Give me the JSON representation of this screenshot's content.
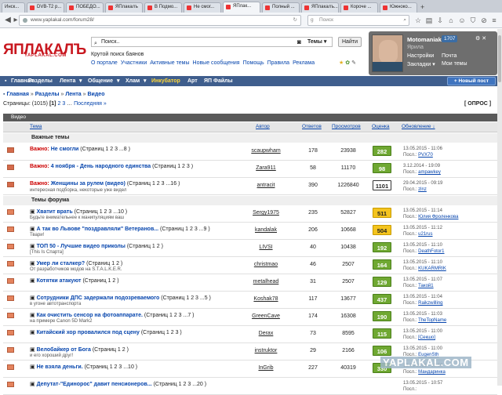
{
  "browser": {
    "tabs": [
      "Инск...",
      "DVB-T2 р...",
      "ПОБЕДО...",
      "ЯПлакалъ",
      "В Подмо...",
      "Не смог...",
      "ЯПлак...",
      "Полный ...",
      "ЯПлакалъ...",
      "Короче ...",
      "Южноко..."
    ],
    "active_tab": 6,
    "url": "www.yaplakal.com/forum28/",
    "search_placeholder": "Поиск"
  },
  "site": {
    "logo": "ЯПЛАКАЛЪ",
    "logo_sub": "YAPLAKAL.COM",
    "search_value": "Поиск..",
    "search_scope": "Темы",
    "find_button": "Найти",
    "tagline": "Крутой поиск баянов",
    "links": [
      "О портале",
      "Участники",
      "Активные темы",
      "Новые сообщения",
      "Помощь",
      "Правила",
      "Реклама"
    ]
  },
  "user": {
    "name": "Motomaniak",
    "count": "1707",
    "status": "Ярила",
    "settings": "Настройки",
    "mail": "Почта",
    "bookmarks": "Закладки",
    "my_topics": "Мои темы"
  },
  "menu": {
    "items": [
      "Главная",
      "Разделы",
      "Лента",
      "Общение",
      "Хлам",
      "Инкубатор",
      "Арт",
      "ЯП Файлы"
    ],
    "new_post": "Новый пост"
  },
  "breadcrumb": [
    "Главная",
    "Разделы",
    "Лента",
    "Видео"
  ],
  "pages": {
    "label": "Страницы:",
    "count": "(1015)",
    "current": "[1]",
    "next": [
      "2",
      "3"
    ],
    "last": "Последняя »"
  },
  "opros": "[ ОПРОС ]",
  "section": "Видео",
  "columns": {
    "topic": "Тема",
    "author": "Автор",
    "answers": "Ответов",
    "views": "Просмотров",
    "rating": "Оценка",
    "updated": "Обновление ↓"
  },
  "groups": {
    "important": "Важные темы",
    "forum": "Темы форума"
  },
  "important_rows": [
    {
      "prefix": "Важно:",
      "title": "Не смогли",
      "pages": "(Страниц 1 2 3 ...8 )",
      "desc": "",
      "author": "scaupwham",
      "answers": "178",
      "views": "23938",
      "rating": "282",
      "color": "green",
      "date": "13.05.2015 - 11:06",
      "last": "PVX70"
    },
    {
      "prefix": "Важно:",
      "title": "4 ноября - День народного единства",
      "pages": "(Страниц 1 2 3 )",
      "desc": "",
      "author": "Zara911",
      "answers": "58",
      "views": "11170",
      "rating": "98",
      "color": "green",
      "date": "3.12.2014 - 19:09",
      "last": "ampawkey"
    },
    {
      "prefix": "Важно:",
      "title": "Женщины за рулем (видео)",
      "pages": "(Страниц 1 2 3 ...16 )",
      "desc": "интересная подборка, некоторые уже видел",
      "author": "antracit",
      "answers": "390",
      "views": "1226840",
      "rating": "1101",
      "color": "white",
      "date": "29.04.2015 - 09:19",
      "last": "zlnz"
    }
  ],
  "forum_rows": [
    {
      "title": "Хватит врать",
      "pages": "(Страниц 1 2 3 ...10 )",
      "desc": "Будьте внимательнее к манипуляциям ваш",
      "author": "Sergy1975",
      "answers": "235",
      "views": "52827",
      "rating": "511",
      "color": "yellow",
      "date": "13.05.2015 - 11:14",
      "last": "Юлия Фроленкова"
    },
    {
      "title": "А так во Львове \"поздравляли\" Ветеранов...",
      "pages": "(Страниц 1 2 3 ...9 )",
      "desc": "Твари!",
      "author": "kandalak",
      "answers": "206",
      "views": "10668",
      "rating": "504",
      "color": "yellow",
      "date": "13.05.2015 - 11:12",
      "last": "u21rus"
    },
    {
      "title": "ТОП 50 - Лучшие видео приколы",
      "pages": "(Страниц 1 2 )",
      "desc": "[This Is Спарта]",
      "author": "LIVSI",
      "answers": "40",
      "views": "10438",
      "rating": "192",
      "color": "green",
      "date": "13.05.2015 - 11:10",
      "last": "DeathFotor1"
    },
    {
      "title": "Умер ли сталкер?",
      "pages": "(Страниц 1 2 )",
      "desc": "От разработчиков модов на S.T.A.L.K.E.R.",
      "author": "christmao",
      "answers": "46",
      "views": "2507",
      "rating": "164",
      "color": "green",
      "date": "13.05.2015 - 11:10",
      "last": "KUKARMRIK"
    },
    {
      "title": "Котятки атакуют",
      "pages": "(Страниц 1 2 )",
      "desc": "",
      "author": "metalhead",
      "answers": "31",
      "views": "2507",
      "rating": "129",
      "color": "green",
      "date": "13.05.2015 - 11:07",
      "last": "Такой1"
    },
    {
      "title": "Сотрудники ДПС задержали подозреваемого",
      "pages": "(Страниц 1 2 3 ...5 )",
      "desc": "в угоне автотранспорта",
      "author": "Koshak78",
      "answers": "117",
      "views": "13677",
      "rating": "437",
      "color": "green",
      "date": "13.05.2015 - 11:04",
      "last": "Raikzwilling"
    },
    {
      "title": "Как очистить сенсор на фотоаппарате.",
      "pages": "(Страниц 1 2 3 ...7 )",
      "desc": "на примере Canon 5D Mark2",
      "author": "GreenCave",
      "answers": "174",
      "views": "16308",
      "rating": "190",
      "color": "green",
      "date": "13.05.2015 - 11:03",
      "last": "TheTopName"
    },
    {
      "title": "Китайский хор провалился под сцену",
      "pages": "(Страниц 1 2 3 )",
      "desc": "",
      "author": "Derax",
      "answers": "73",
      "views": "8595",
      "rating": "115",
      "color": "green",
      "date": "13.05.2015 - 11:00",
      "last": "[Секшо]"
    },
    {
      "title": "Велобайкер от Бога",
      "pages": "(Страниц 1 2 )",
      "desc": "и его хороший друг!",
      "author": "instruktor",
      "answers": "29",
      "views": "2166",
      "rating": "106",
      "color": "green",
      "date": "13.05.2015 - 11:00",
      "last": "EugenSth"
    },
    {
      "title": "Не взяла деньги.",
      "pages": "(Страниц 1 2 3 ...10 )",
      "desc": "",
      "author": "InGrib",
      "answers": "227",
      "views": "40319",
      "rating": "330",
      "color": "green",
      "date": "13.05.2015 - 10:59",
      "last": "Мандаринка"
    },
    {
      "title": "Депутат-\"Единорос\" давит пенсионеров...",
      "pages": "(Страниц 1 2 3 ...20 )",
      "desc": "",
      "author": "",
      "answers": "",
      "views": "",
      "rating": "",
      "color": "green",
      "date": "13.05.2015 - 10:57",
      "last": ""
    }
  ],
  "watermark": "YAPLAKAL.COM"
}
